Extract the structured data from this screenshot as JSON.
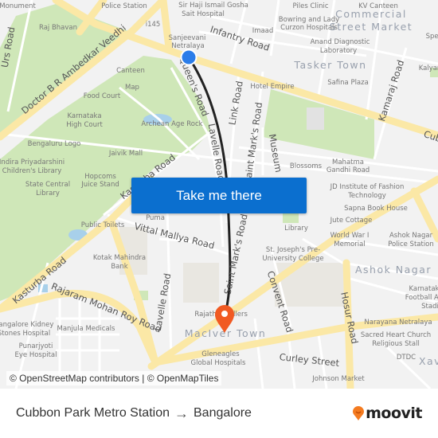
{
  "map": {
    "colors": {
      "background": "#f2f2f2",
      "park": "#cfe7b8",
      "major_road": "#fbe8a6",
      "minor_road": "#ffffff",
      "route_line": "#222222",
      "start_marker": "#2b7de9",
      "end_marker": "#f15a22",
      "button": "#0b6fcf"
    },
    "road_labels": {
      "infantry": "Infantry Road",
      "ambedkar": "Doctor B R Ambedkar Veedhi",
      "queens": "Queen's Road",
      "link": "Link Road",
      "st_marks": "Saint Mark's Road",
      "st_marks_upper": "Saint Mark's Road",
      "museum": "Museum",
      "kamaraj": "Kamaraj Road",
      "cubbon": "Cub",
      "kasturba_upper": "Kasturba Road",
      "kasturba": "Kasturba Road",
      "vittal": "Vittal Mallya Road",
      "lavelle": "Lavelle Road",
      "lavelle_upper": "Lavelle Road",
      "rajaram": "Rajaram Mohan Roy Road",
      "convent": "Convent Road",
      "hosur": "Hosur Road",
      "curley": "Curley Street",
      "urs": "Urs Road"
    },
    "area_labels": {
      "commercial": "Commercial",
      "street_market": "Street Market",
      "tasker": "Tasker Town",
      "ashok": "Ashok Nagar",
      "maciver": "MacIver Town"
    },
    "poi_labels": [
      "Police Station",
      "Sir Haji Ismail Gosha",
      "Sait Hospital",
      "i145",
      "Sanjeevani",
      "Netralaya",
      "Raj Bhavan",
      "Piles Clinic",
      "KV Canteen",
      "Bowring and Lady",
      "Curzon Hospitals",
      "Imaad",
      "Anand Diagnostic",
      "Laboratory",
      "Safina Plaza",
      "Hotel Empire",
      "Kalyan",
      "Canteen",
      "Map",
      "Food Court",
      "Karnataka",
      "High Court",
      "Archean Age Rock",
      "Bengaluru Logo",
      "Jaivik Mall",
      "Indira Priyadarshini",
      "Children's Library",
      "Hopcoms",
      "Juice Stand",
      "State Central",
      "Library",
      "Blossoms",
      "Mahatma",
      "Gandhi Road",
      "JD Institute of Fashion",
      "Technology",
      "Sapna Book House",
      "Jute Cottage",
      "Library",
      "World War I",
      "Memorial",
      "Ashok Nagar",
      "Police Station",
      "St. Joseph's Pre-",
      "University College",
      "Puma",
      "Public Toilets",
      "Kotak Mahindra",
      "Bank",
      "Karnataka",
      "Football As",
      "Stadi",
      "Narayana Netralaya",
      "Sacred Heart Church",
      "Religious Stall",
      "DTDC",
      "Xav",
      "Rajath",
      "llers",
      "Gleneagles",
      "Global Hospitals",
      "Bangalore Kidney",
      "Stones Hospital",
      "Manjula Medicals",
      "Punarjyoti",
      "Eye Hospital",
      "Johnson Market",
      "Spec",
      "Monument"
    ],
    "cta_label": "Take me there",
    "attribution": "© OpenStreetMap contributors | © OpenMapTiles"
  },
  "footer": {
    "origin": "Cubbon Park Metro Station",
    "arrow": "→",
    "destination": "Bangalore",
    "logo_text": "moovit"
  }
}
